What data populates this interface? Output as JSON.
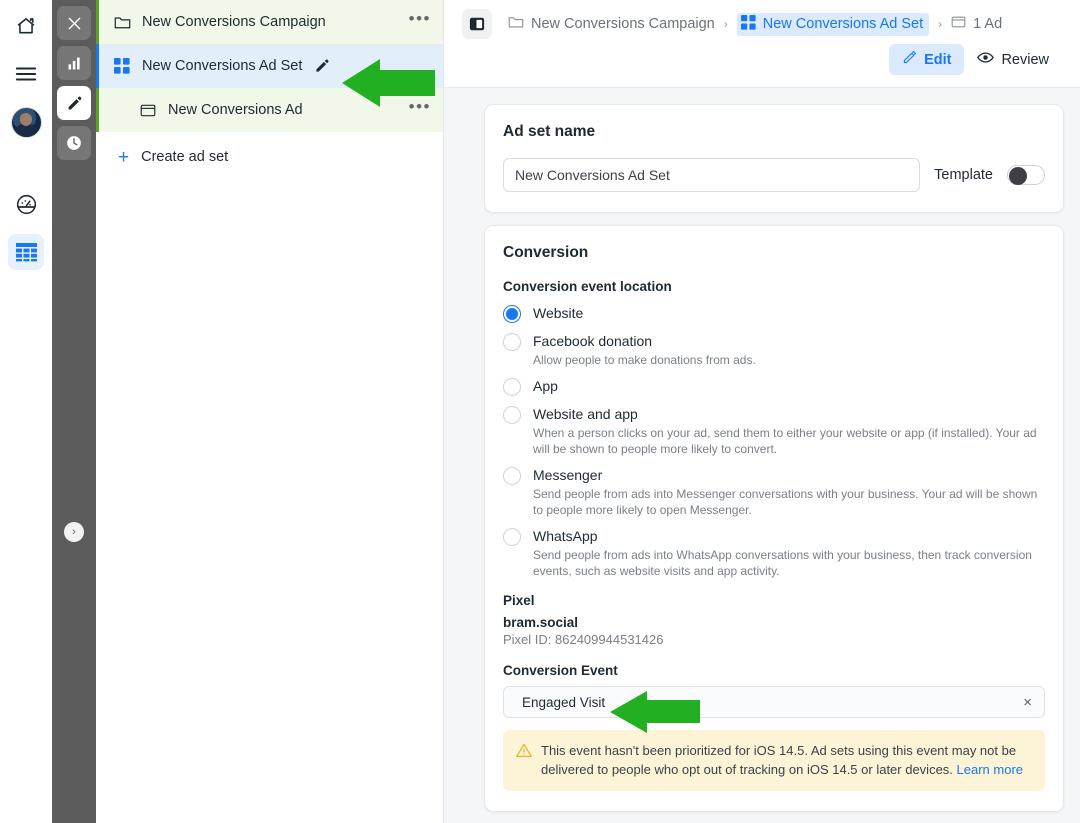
{
  "icon_rail": {
    "items": [
      {
        "name": "home-icon",
        "label": "Home"
      },
      {
        "name": "menu-icon",
        "label": "Menu"
      },
      {
        "name": "avatar",
        "label": "Profile"
      },
      {
        "name": "speedometer-icon",
        "label": "Performance"
      },
      {
        "name": "grid-table-icon",
        "label": "Ads Manager"
      }
    ]
  },
  "dark_strip": {
    "items": [
      {
        "name": "close-icon",
        "label": "Close"
      },
      {
        "name": "bar-chart-icon",
        "label": "Charts"
      },
      {
        "name": "pencil-icon",
        "label": "Edit"
      },
      {
        "name": "clock-icon",
        "label": "History"
      }
    ],
    "expand_label": "›"
  },
  "tree": {
    "campaign": {
      "label": "New Conversions Campaign",
      "icon": "folder-icon",
      "menu": "•••"
    },
    "adset": {
      "label": "New Conversions Ad Set",
      "icon": "grid-blue-icon",
      "edit_icon": "pencil-icon"
    },
    "ad": {
      "label": "New Conversions Ad",
      "icon": "window-icon",
      "menu": "•••"
    },
    "create": {
      "plus": "+",
      "label": "Create ad set"
    }
  },
  "breadcrumb": {
    "panel_toggle": "panel-toggle-icon",
    "items": [
      {
        "label": "New Conversions Campaign",
        "icon": "folder-icon",
        "selected": false
      },
      {
        "label": "New Conversions Ad Set",
        "icon": "grid-blue-icon",
        "selected": true
      },
      {
        "label": "1 Ad",
        "icon": "window-icon",
        "selected": false
      }
    ],
    "separator": "›"
  },
  "toolbar": {
    "edit_label": "Edit",
    "review_label": "Review"
  },
  "adset_name_card": {
    "title": "Ad set name",
    "value": "New Conversions Ad Set",
    "template_label": "Template",
    "template_on": false
  },
  "conversion_card": {
    "title": "Conversion",
    "event_location_label": "Conversion event location",
    "options": [
      {
        "label": "Website",
        "desc": "",
        "selected": true
      },
      {
        "label": "Facebook donation",
        "desc": "Allow people to make donations from ads.",
        "selected": false
      },
      {
        "label": "App",
        "desc": "",
        "selected": false
      },
      {
        "label": "Website and app",
        "desc": "When a person clicks on your ad, send them to either your website or app (if installed). Your ad will be shown to people more likely to convert.",
        "selected": false
      },
      {
        "label": "Messenger",
        "desc": "Send people from ads into Messenger conversations with your business. Your ad will be shown to people more likely to open Messenger.",
        "selected": false
      },
      {
        "label": "WhatsApp",
        "desc": "Send people from ads into WhatsApp conversations with your business, then track conversion events, such as website visits and app activity.",
        "selected": false
      }
    ],
    "pixel_label": "Pixel",
    "pixel_name": "bram.social",
    "pixel_id": "Pixel ID: 862409944531426",
    "conversion_event_label": "Conversion Event",
    "conversion_event_value": "Engaged Visit",
    "clear_icon": "×",
    "warning": {
      "icon": "warning-triangle-icon",
      "text": "This event hasn't been prioritized for iOS 14.5. Ad sets using this event may not be delivered to people who opt out of tracking on iOS 14.5 or later devices. ",
      "link": "Learn more"
    }
  },
  "annotations": {
    "arrow_color": "#22b022",
    "arrows": [
      {
        "name": "arrow-pointing-at-ad-set-row"
      },
      {
        "name": "arrow-pointing-at-conversion-event"
      }
    ]
  }
}
